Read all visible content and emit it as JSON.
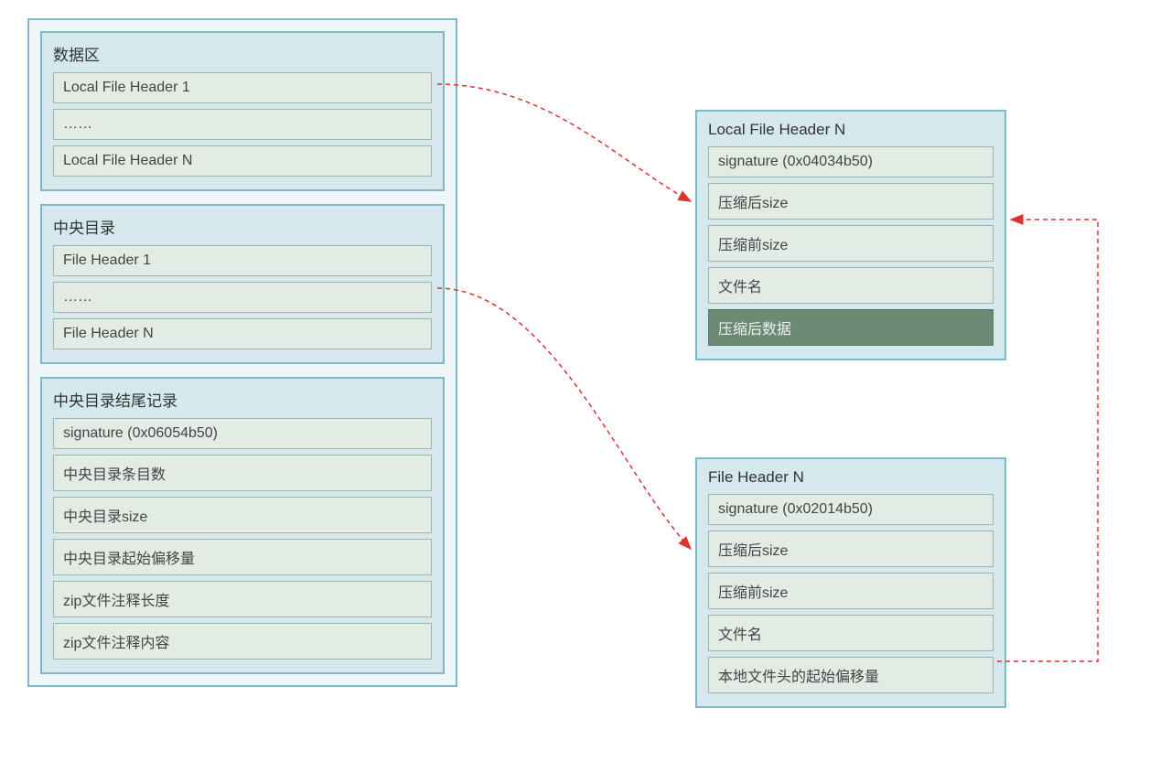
{
  "left": {
    "data_area": {
      "title": "数据区",
      "rows": [
        "Local File Header 1",
        "……",
        "Local File Header N"
      ]
    },
    "central_dir": {
      "title": "中央目录",
      "rows": [
        "File Header 1",
        "……",
        "File Header N"
      ]
    },
    "eocd": {
      "title": "中央目录结尾记录",
      "rows": [
        "signature (0x06054b50)",
        "中央目录条目数",
        "中央目录size",
        "中央目录起始偏移量",
        "zip文件注释长度",
        "zip文件注释内容"
      ]
    }
  },
  "right": {
    "lfh": {
      "title": "Local File Header N",
      "rows": [
        "signature (0x04034b50)",
        "压缩后size",
        "压缩前size",
        "文件名",
        "压缩后数据"
      ]
    },
    "fh": {
      "title": "File Header N",
      "rows": [
        "signature (0x02014b50)",
        "压缩后size",
        "压缩前size",
        "文件名",
        "本地文件头的起始偏移量"
      ]
    }
  }
}
